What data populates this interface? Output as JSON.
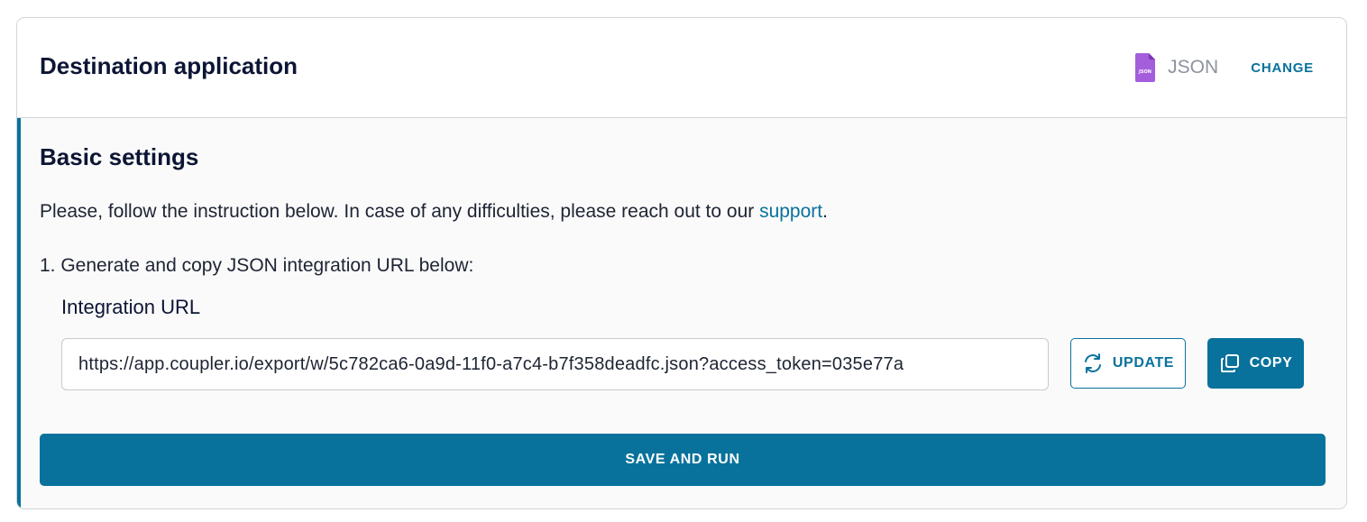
{
  "header": {
    "title": "Destination application",
    "destination_icon": "json-file-icon",
    "destination_icon_text": "JSON",
    "destination_name": "JSON",
    "change_label": "CHANGE"
  },
  "basic_settings": {
    "title": "Basic settings",
    "intro_text": "Please, follow the instruction below. In case of any difficulties, please reach out to our ",
    "support_link": "support",
    "intro_end": ".",
    "step_1": "1. Generate and copy JSON integration URL below:",
    "field_label": "Integration URL",
    "integration_url": "https://app.coupler.io/export/w/5c782ca6-0a9d-11f0-a7c4-b7f358deadfc.json?access_token=035e77a",
    "update_label": "UPDATE",
    "update_icon": "refresh-icon",
    "copy_label": "COPY",
    "copy_icon": "copy-icon"
  },
  "footer": {
    "save_label": "SAVE AND RUN"
  },
  "colors": {
    "accent": "#08729c",
    "json_icon": "#a45ddb",
    "title": "#0c1534",
    "muted": "#8d939e"
  }
}
